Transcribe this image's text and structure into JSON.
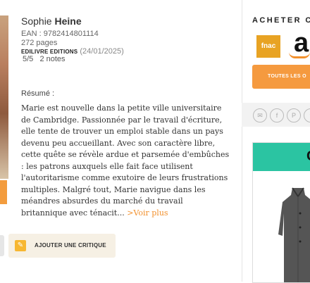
{
  "book": {
    "author_first": "Sophie",
    "author_last": "Heine",
    "ean": "EAN : 9782414801114",
    "pages": "272 pages",
    "publisher": "EDILIVRE EDITIONS",
    "date": "(24/01/2025)",
    "rating": "5/5",
    "notes": "2 notes"
  },
  "resume": {
    "label": "Résumé :",
    "text": "Marie est nouvelle dans la petite ville universitaire de Cambridge. Passionnée par le travail d'écriture, elle tente de trouver un emploi stable dans un pays devenu peu accueillant. Avec son caractère libre, cette quête se révèle ardue et parsemée d'embûches : les patrons auxquels elle fait face utilisent l'autoritarisme comme exutoire de leurs frustrations multiples. Malgré tout, Marie navigue dans les méandres absurdes du marché du travail britannique avec ténacit...",
    "more": ">Voir plus"
  },
  "actions": {
    "critique_label": "AJOUTER UNE CRITIQUE"
  },
  "sidebar": {
    "buy_title": "ACHETER C",
    "fnac": "fnac",
    "amazon": "a",
    "all_offers": "TOUTES LES O",
    "social": [
      "✉",
      "f",
      "P",
      "t"
    ],
    "ad_letter": "C"
  },
  "colors": {
    "accent": "#f59a3f",
    "ad_header": "#2bc4a2",
    "fnac": "#e8a323"
  }
}
